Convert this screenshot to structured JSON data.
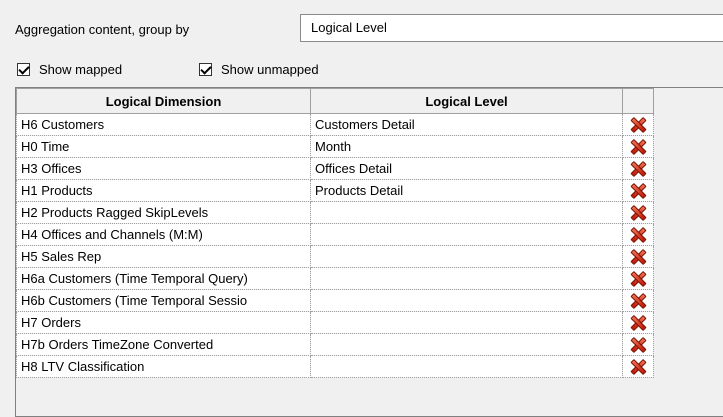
{
  "group_by": {
    "label": "Aggregation content, group by",
    "value": "Logical Level"
  },
  "checkboxes": [
    {
      "label": "Show mapped",
      "checked": true
    },
    {
      "label": "Show unmapped",
      "checked": true
    }
  ],
  "table": {
    "headers": [
      "Logical Dimension",
      "Logical Level"
    ],
    "rows": [
      {
        "dimension": "H6 Customers",
        "level": "Customers Detail"
      },
      {
        "dimension": "H0 Time",
        "level": "Month"
      },
      {
        "dimension": "H3 Offices",
        "level": "Offices Detail"
      },
      {
        "dimension": "H1 Products",
        "level": "Products Detail"
      },
      {
        "dimension": "H2 Products Ragged SkipLevels",
        "level": ""
      },
      {
        "dimension": "H4 Offices and Channels (M:M)",
        "level": ""
      },
      {
        "dimension": "H5 Sales Rep",
        "level": ""
      },
      {
        "dimension": "H6a Customers (Time Temporal Query)",
        "level": ""
      },
      {
        "dimension": "H6b Customers (Time Temporal Sessio",
        "level": ""
      },
      {
        "dimension": "H7 Orders",
        "level": ""
      },
      {
        "dimension": "H7b Orders TimeZone Converted",
        "level": ""
      },
      {
        "dimension": "H8 LTV Classification",
        "level": ""
      }
    ],
    "row_action_icon": "delete-x-icon"
  },
  "colors": {
    "window_bg": "#f0f0f0",
    "delete_icon": "#d42a10"
  }
}
